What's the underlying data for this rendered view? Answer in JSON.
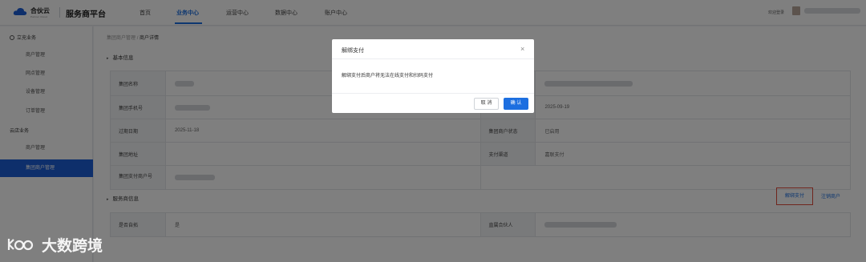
{
  "header": {
    "logo_text": "合伙云",
    "logo_subtext": "Partner Cloud",
    "platform": "服务商平台",
    "nav": [
      "首页",
      "业务中心",
      "运营中心",
      "数据中心",
      "账户中心"
    ],
    "welcome": "欢迎登录"
  },
  "sidebar": {
    "group1": "立充业务",
    "group1_items": [
      "商户管理",
      "网点管理",
      "设备管理",
      "订单管理"
    ],
    "group2": "云店业务",
    "group2_items": [
      "商户管理",
      "集团商户管理"
    ]
  },
  "breadcrumb": {
    "parent": "集团商户管理",
    "sep": "/",
    "current": "商户详情"
  },
  "sections": {
    "basic": "基本信息",
    "service": "服务商信息"
  },
  "basic": {
    "row1": {
      "k1": "集团名称",
      "k2": ""
    },
    "row2": {
      "k1": "集团手机号",
      "k2": "",
      "v2": "2025-09-19"
    },
    "row3": {
      "k1": "过期日期",
      "v1": "2025-11-18",
      "k2": "集团商户状态",
      "v2": "已启用"
    },
    "row4": {
      "k1": "集团地址",
      "v1": "",
      "k2": "支付渠道",
      "v2": "嘉联支付"
    },
    "row5": {
      "k1": "集团支付商户号"
    }
  },
  "actions": {
    "unbind": "解绑支付",
    "cancel": "注销商户"
  },
  "service": {
    "k1": "是否自拓",
    "v1": "是",
    "k2": "直属合伙人"
  },
  "modal": {
    "title": "解绑支付",
    "close": "×",
    "message": "解绑支付后商户将无法在线支付和扫码支付",
    "cancel": "取 消",
    "confirm": "确 认"
  },
  "watermark": "大数跨境",
  "colors": {
    "accent": "#1d6fe0",
    "highlight_border": "#e04a3a"
  }
}
